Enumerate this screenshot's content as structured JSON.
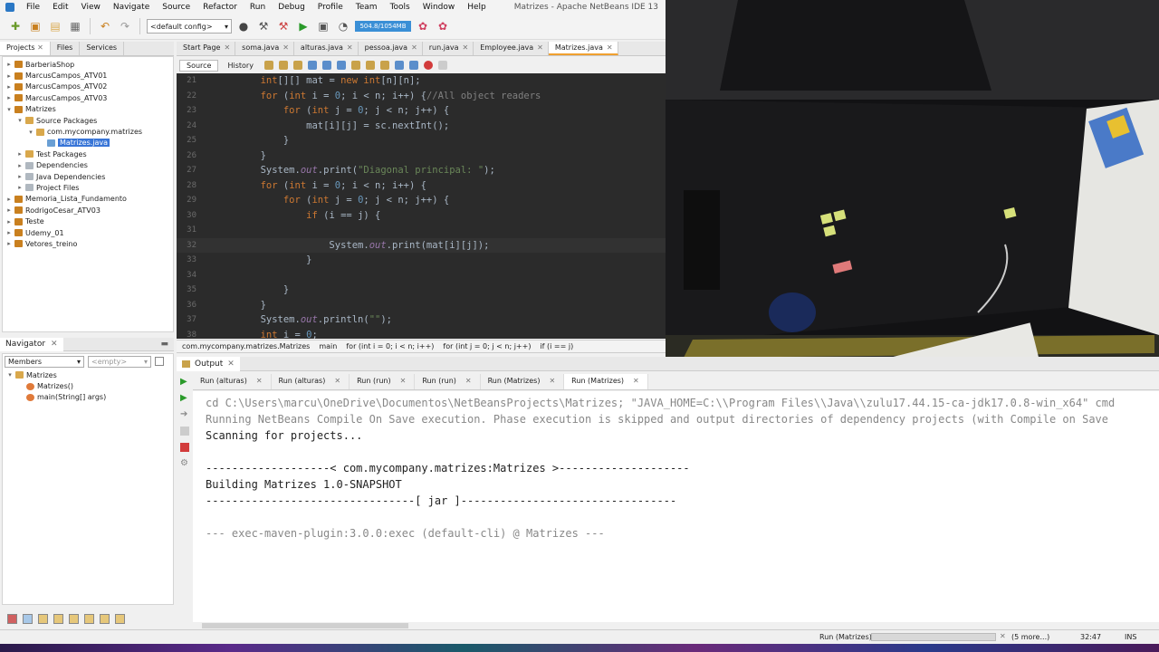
{
  "window": {
    "title": "Matrizes - Apache NetBeans IDE 13",
    "menus": [
      "File",
      "Edit",
      "View",
      "Navigate",
      "Source",
      "Refactor",
      "Run",
      "Debug",
      "Profile",
      "Team",
      "Tools",
      "Window",
      "Help"
    ]
  },
  "toolbar": {
    "config": "<default config>",
    "memory": "504.8/1054MB"
  },
  "projects_panel": {
    "tabs": [
      "Projects",
      "Files",
      "Services"
    ],
    "tree": [
      {
        "label": "BarberiaShop",
        "level": 0,
        "icon": "project-icon",
        "exp": "+"
      },
      {
        "label": "MarcusCampos_ATV01",
        "level": 0,
        "icon": "project-icon",
        "exp": "+"
      },
      {
        "label": "MarcusCampos_ATV02",
        "level": 0,
        "icon": "project-icon",
        "exp": "+"
      },
      {
        "label": "MarcusCampos_ATV03",
        "level": 0,
        "icon": "project-icon",
        "exp": "+"
      },
      {
        "label": "Matrizes",
        "level": 0,
        "icon": "project-icon",
        "exp": "-"
      },
      {
        "label": "Source Packages",
        "level": 1,
        "icon": "package-folder-icon",
        "exp": "-"
      },
      {
        "label": "com.mycompany.matrizes",
        "level": 2,
        "icon": "package-icon",
        "exp": "-"
      },
      {
        "label": "Matrizes.java",
        "level": 3,
        "icon": "java-file-icon",
        "exp": "",
        "selected": true
      },
      {
        "label": "Test Packages",
        "level": 1,
        "icon": "package-folder-icon",
        "exp": "+"
      },
      {
        "label": "Dependencies",
        "level": 1,
        "icon": "dependency-icon",
        "exp": "+"
      },
      {
        "label": "Java Dependencies",
        "level": 1,
        "icon": "dependency-icon",
        "exp": "+"
      },
      {
        "label": "Project Files",
        "level": 1,
        "icon": "dependency-icon",
        "exp": "+"
      },
      {
        "label": "Memoria_Lista_Fundamento",
        "level": 0,
        "icon": "project-icon",
        "exp": "+"
      },
      {
        "label": "RodrigoCesar_ATV03",
        "level": 0,
        "icon": "project-icon",
        "exp": "+"
      },
      {
        "label": "Teste",
        "level": 0,
        "icon": "project-icon",
        "exp": "+"
      },
      {
        "label": "Udemy_01",
        "level": 0,
        "icon": "project-icon",
        "exp": "+"
      },
      {
        "label": "Vetores_treino",
        "level": 0,
        "icon": "project-icon",
        "exp": "+"
      }
    ]
  },
  "navigator": {
    "title": "Navigator",
    "members_select": "Members",
    "filter_select": "<empty>",
    "items": [
      {
        "label": "Matrizes",
        "level": 0
      },
      {
        "label": "Matrizes()",
        "level": 1
      },
      {
        "label": "main(String[] args)",
        "level": 1
      }
    ]
  },
  "editor": {
    "tabs": [
      "Start Page",
      "soma.java",
      "alturas.java",
      "pessoa.java",
      "run.java",
      "Employee.java",
      "Matrizes.java"
    ],
    "active_tab": "Matrizes.java",
    "source_label": "Source",
    "history_label": "History",
    "breadcrumb": [
      "com.mycompany.matrizes.Matrizes",
      "main",
      "for (int i = 0; i < n; i++)",
      "for (int j = 0; j < n; j++)",
      "if (i == j)"
    ]
  },
  "output": {
    "title": "Output",
    "run_tabs": [
      "Run (alturas)",
      "Run (alturas)",
      "Run (run)",
      "Run (run)",
      "Run (Matrizes)",
      "Run (Matrizes)"
    ],
    "lines": [
      {
        "text": "cd C:\\Users\\marcu\\OneDrive\\Documentos\\NetBeansProjects\\Matrizes; \"JAVA_HOME=C:\\\\Program Files\\\\Java\\\\zulu17.44.15-ca-jdk17.0.8-win_x64\" cmd",
        "grey": true
      },
      {
        "text": "Running NetBeans Compile On Save execution. Phase execution is skipped and output directories of dependency projects (with Compile on Save",
        "grey": true
      },
      {
        "text": "Scanning for projects...",
        "grey": false
      },
      {
        "text": "",
        "grey": false
      },
      {
        "text": "-------------------< com.mycompany.matrizes:Matrizes >--------------------",
        "grey": false
      },
      {
        "text": "Building Matrizes 1.0-SNAPSHOT",
        "grey": false
      },
      {
        "text": "--------------------------------[ jar ]---------------------------------",
        "grey": false
      },
      {
        "text": "",
        "grey": false
      },
      {
        "text": "--- exec-maven-plugin:3.0.0:exec (default-cli) @ Matrizes ---",
        "grey": true
      }
    ]
  },
  "statusbar": {
    "task": "Run (Matrizes)",
    "more": "(5 more...)",
    "position": "32:47",
    "mode": "INS"
  }
}
